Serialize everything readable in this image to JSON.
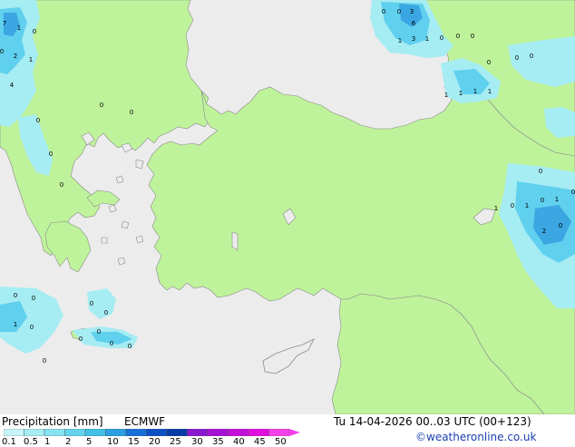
{
  "title": "Precipitation [mm]",
  "model": "ECMWF",
  "datetime": "Tu 14-04-2026 00..03 UTC (00+123)",
  "credit": "©weatheronline.co.uk",
  "colors": {
    "sea": "#ececec",
    "land": "#bff39b",
    "precip_light": "#a6ecf3",
    "precip_medium": "#5fd0ee",
    "precip_heavy": "#3aa6e2"
  },
  "legend": {
    "ticks": [
      "0.1",
      "0.5",
      "1",
      "2",
      "5",
      "10",
      "15",
      "20",
      "25",
      "30",
      "35",
      "40",
      "45",
      "50"
    ],
    "colors": [
      "#c8f5f9",
      "#a6ecf3",
      "#86e2f0",
      "#64d3ec",
      "#42c0e6",
      "#2c9fe2",
      "#1870d8",
      "#0d4fc4",
      "#083aa6",
      "#8a17d1",
      "#a60fd6",
      "#c40ed9",
      "#e20ee0",
      "#f53fea"
    ]
  },
  "values": [
    {
      "t": "7"
    },
    {
      "t": "1"
    },
    {
      "t": "0"
    },
    {
      "t": "0"
    },
    {
      "t": "2"
    },
    {
      "t": "1"
    },
    {
      "t": "4"
    },
    {
      "t": "0"
    },
    {
      "t": "0"
    },
    {
      "t": "3"
    },
    {
      "t": "6"
    },
    {
      "t": "1"
    },
    {
      "t": "3"
    },
    {
      "t": "1"
    },
    {
      "t": "0"
    },
    {
      "t": "0"
    },
    {
      "t": "0"
    },
    {
      "t": "0"
    },
    {
      "t": "0"
    },
    {
      "t": "0"
    },
    {
      "t": "1"
    },
    {
      "t": "1"
    },
    {
      "t": "1"
    },
    {
      "t": "1"
    },
    {
      "t": "0"
    },
    {
      "t": "0"
    },
    {
      "t": "0"
    },
    {
      "t": "0"
    },
    {
      "t": "0"
    },
    {
      "t": "0"
    },
    {
      "t": "1"
    },
    {
      "t": "0"
    },
    {
      "t": "1"
    },
    {
      "t": "0"
    },
    {
      "t": "1"
    },
    {
      "t": "2"
    },
    {
      "t": "0"
    },
    {
      "t": "0"
    },
    {
      "t": "1"
    },
    {
      "t": "0"
    },
    {
      "t": "0"
    },
    {
      "t": "0"
    },
    {
      "t": "0"
    },
    {
      "t": "0"
    },
    {
      "t": "0"
    },
    {
      "t": "0"
    },
    {
      "t": "0"
    },
    {
      "t": "0"
    },
    {
      "t": "0"
    }
  ]
}
